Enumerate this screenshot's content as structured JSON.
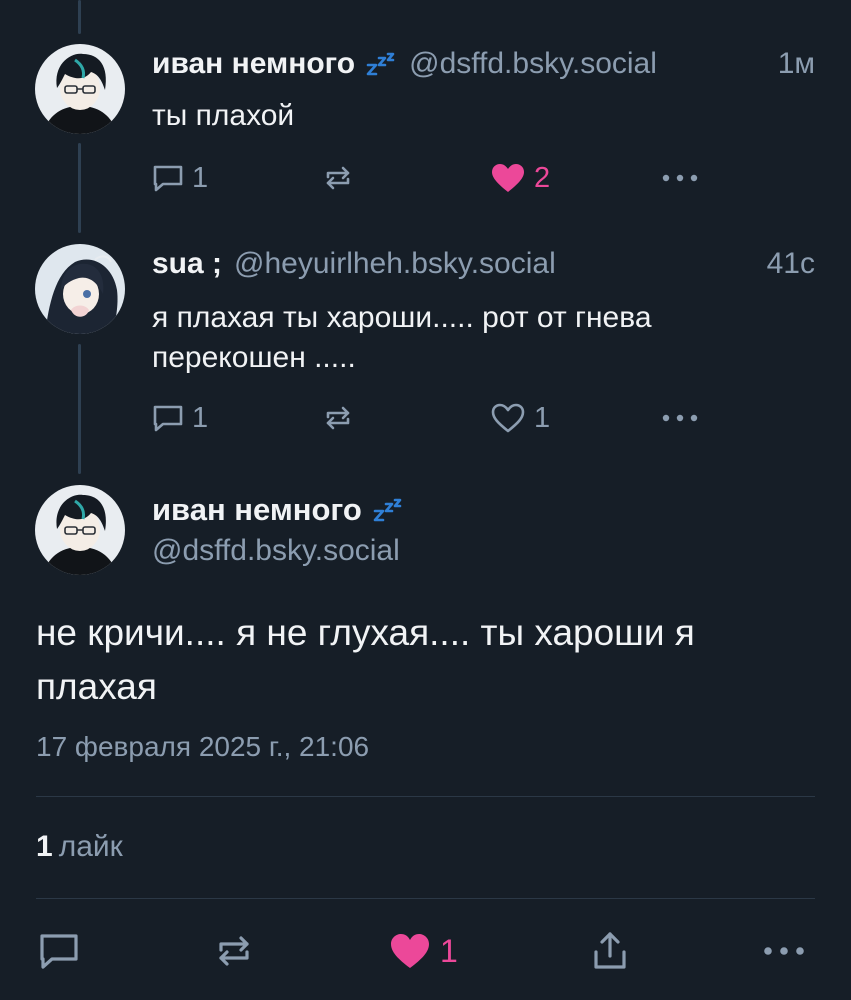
{
  "thread": {
    "posts": [
      {
        "display_name": "иван немного",
        "handle": "@dsffd.bsky.social",
        "time": "1м",
        "text": "ты плахой",
        "replies": "1",
        "likes": "2",
        "liked": true
      },
      {
        "display_name": "sua ;",
        "handle": "@heyuirlheh.bsky.social",
        "time": "41с",
        "text": "я плахая ты хароши..... рот от гнева перекошен .....",
        "replies": "1",
        "likes": "1",
        "liked": false
      }
    ]
  },
  "main_post": {
    "display_name": "иван немного",
    "handle": "@dsffd.bsky.social",
    "text": "не кричи.... я не глухая.... ты хароши я плахая",
    "date": "17 февраля 2025 г., 21:06",
    "like_count": "1",
    "like_label": "лайк",
    "likes": "1"
  },
  "icons": {
    "reply": "reply-bubble-icon",
    "repost": "repost-icon",
    "like": "heart-icon",
    "share": "share-icon",
    "more": "more-dots-icon",
    "sleepy": "zzz-emoji-icon"
  },
  "colors": {
    "background": "#161e27",
    "muted_text": "#8c9db0",
    "like_pink": "#ec4899",
    "thread_line": "#2e4052",
    "divider": "#2b3846"
  }
}
